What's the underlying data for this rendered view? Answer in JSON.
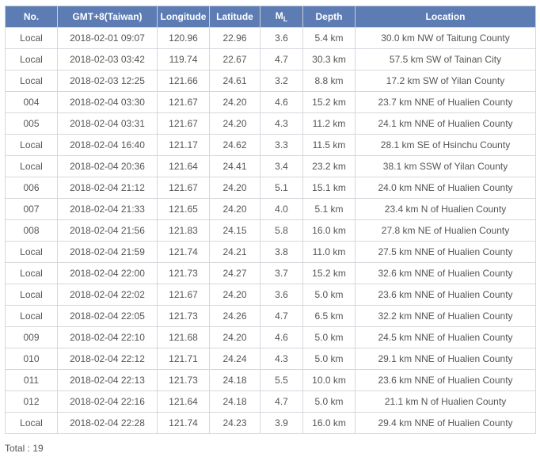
{
  "table": {
    "headers": {
      "no": "No.",
      "time": "GMT+8(Taiwan)",
      "longitude": "Longitude",
      "latitude": "Latitude",
      "ml_main": "M",
      "ml_sub": "L",
      "depth": "Depth",
      "location": "Location"
    },
    "rows": [
      [
        "Local",
        "2018-02-01 09:07",
        "120.96",
        "22.96",
        "3.6",
        "5.4 km",
        "30.0 km NW of Taitung County"
      ],
      [
        "Local",
        "2018-02-03 03:42",
        "119.74",
        "22.67",
        "4.7",
        "30.3 km",
        "57.5 km SW of Tainan City"
      ],
      [
        "Local",
        "2018-02-03 12:25",
        "121.66",
        "24.61",
        "3.2",
        "8.8 km",
        "17.2 km SW of Yilan County"
      ],
      [
        "004",
        "2018-02-04 03:30",
        "121.67",
        "24.20",
        "4.6",
        "15.2 km",
        "23.7 km NNE of Hualien County"
      ],
      [
        "005",
        "2018-02-04 03:31",
        "121.67",
        "24.20",
        "4.3",
        "11.2 km",
        "24.1 km NNE of Hualien County"
      ],
      [
        "Local",
        "2018-02-04 16:40",
        "121.17",
        "24.62",
        "3.3",
        "11.5 km",
        "28.1 km SE of Hsinchu County"
      ],
      [
        "Local",
        "2018-02-04 20:36",
        "121.64",
        "24.41",
        "3.4",
        "23.2 km",
        "38.1 km SSW of Yilan County"
      ],
      [
        "006",
        "2018-02-04 21:12",
        "121.67",
        "24.20",
        "5.1",
        "15.1 km",
        "24.0 km NNE of Hualien County"
      ],
      [
        "007",
        "2018-02-04 21:33",
        "121.65",
        "24.20",
        "4.0",
        "5.1 km",
        "23.4 km N of Hualien County"
      ],
      [
        "008",
        "2018-02-04 21:56",
        "121.83",
        "24.15",
        "5.8",
        "16.0 km",
        "27.8 km NE of Hualien County"
      ],
      [
        "Local",
        "2018-02-04 21:59",
        "121.74",
        "24.21",
        "3.8",
        "11.0 km",
        "27.5 km NNE of Hualien County"
      ],
      [
        "Local",
        "2018-02-04 22:00",
        "121.73",
        "24.27",
        "3.7",
        "15.2 km",
        "32.6 km NNE of Hualien County"
      ],
      [
        "Local",
        "2018-02-04 22:02",
        "121.67",
        "24.20",
        "3.6",
        "5.0 km",
        "23.6 km NNE of Hualien County"
      ],
      [
        "Local",
        "2018-02-04 22:05",
        "121.73",
        "24.26",
        "4.7",
        "6.5 km",
        "32.2 km NNE of Hualien County"
      ],
      [
        "009",
        "2018-02-04 22:10",
        "121.68",
        "24.20",
        "4.6",
        "5.0 km",
        "24.5 km NNE of Hualien County"
      ],
      [
        "010",
        "2018-02-04 22:12",
        "121.71",
        "24.24",
        "4.3",
        "5.0 km",
        "29.1 km NNE of Hualien County"
      ],
      [
        "011",
        "2018-02-04 22:13",
        "121.73",
        "24.18",
        "5.5",
        "10.0 km",
        "23.6 km NNE of Hualien County"
      ],
      [
        "012",
        "2018-02-04 22:16",
        "121.64",
        "24.18",
        "4.7",
        "5.0 km",
        "21.1 km N of Hualien County"
      ],
      [
        "Local",
        "2018-02-04 22:28",
        "121.74",
        "24.23",
        "3.9",
        "16.0 km",
        "29.4 km NNE of Hualien County"
      ]
    ]
  },
  "footer": {
    "total_label": "Total : 19"
  },
  "colors": {
    "header_bg": "#5d7cb4",
    "header_text": "#ffffff",
    "border": "#d4d8de",
    "text": "#555555"
  }
}
